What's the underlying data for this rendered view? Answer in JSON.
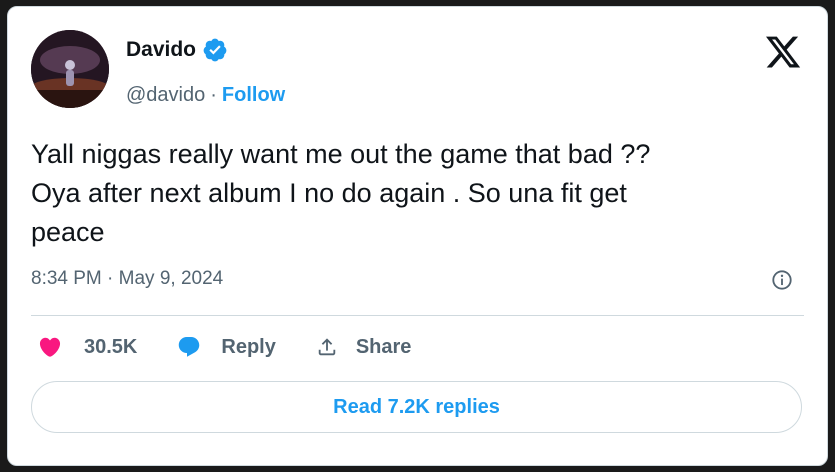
{
  "author": {
    "name": "Davido",
    "handle": "@davido",
    "separator": "·",
    "follow_label": "Follow",
    "verified": true
  },
  "tweet": {
    "text": "Yall niggas really want me out the game that bad ??\nOya after next album I no do again . So una fit get\npeace",
    "timestamp": "8:34 PM · May 9, 2024"
  },
  "actions": {
    "likes": "30.5K",
    "reply_label": "Reply",
    "share_label": "Share"
  },
  "read_replies_label": "Read 7.2K replies",
  "colors": {
    "accent": "#1d9bf0",
    "like": "#f91880",
    "text": "#0f1419",
    "muted": "#536471"
  },
  "icons": [
    "verified-badge-icon",
    "x-logo-icon",
    "info-icon",
    "heart-icon",
    "reply-bubble-icon",
    "share-icon"
  ]
}
